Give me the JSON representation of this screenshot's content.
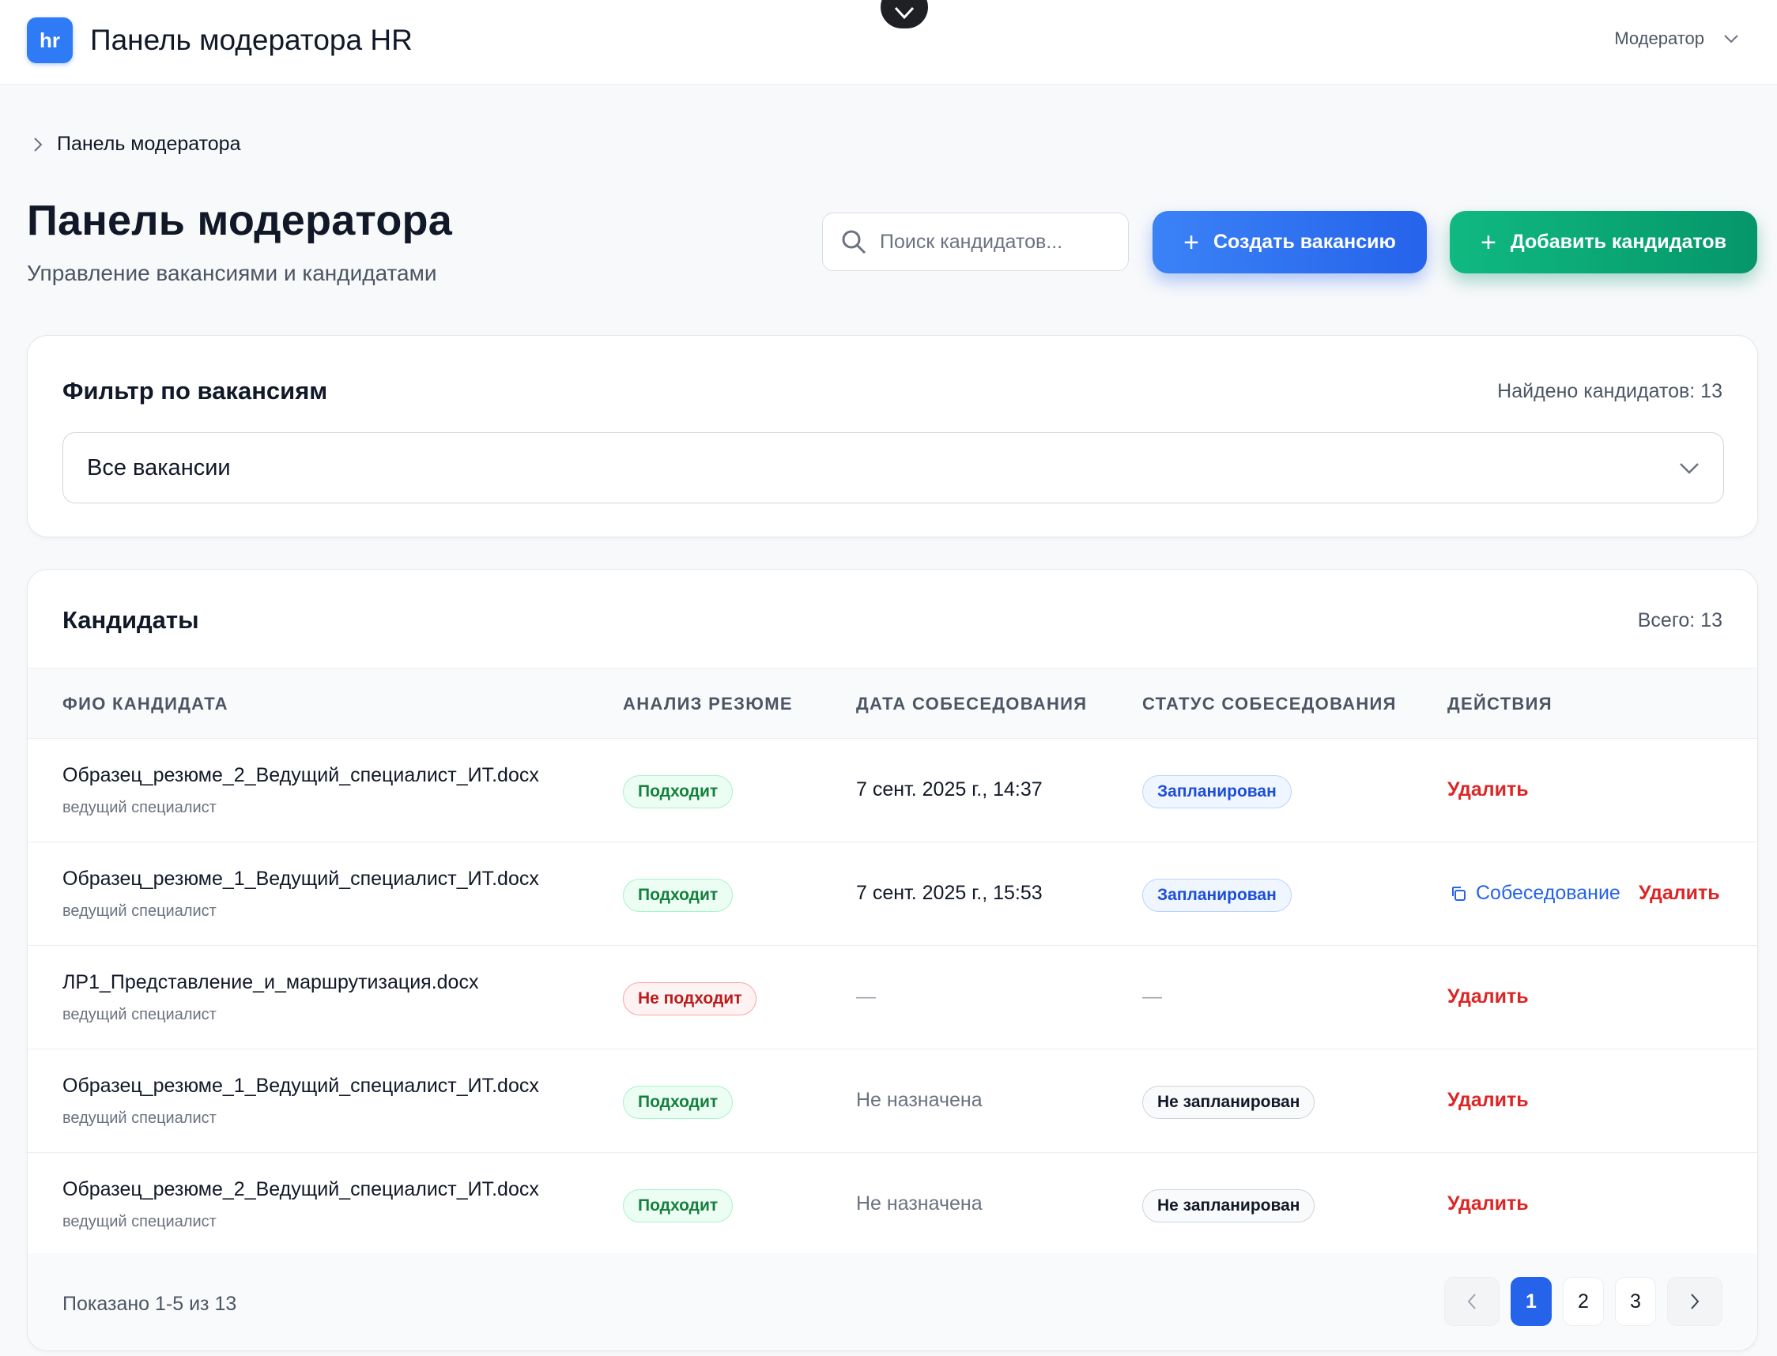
{
  "header": {
    "logo_text": "hr",
    "app_title": "Панель модератора HR",
    "role": "Модератор"
  },
  "breadcrumb": {
    "current": "Панель модератора"
  },
  "page": {
    "title": "Панель модератора",
    "subtitle": "Управление вакансиями и кандидатами"
  },
  "search": {
    "placeholder": "Поиск кандидатов..."
  },
  "buttons": {
    "create_vacancy": "Создать вакансию",
    "add_candidates": "Добавить кандидатов"
  },
  "filter": {
    "title": "Фильтр по вакансиям",
    "found_text": "Найдено кандидатов: 13",
    "selected": "Все вакансии"
  },
  "candidates": {
    "title": "Кандидаты",
    "total_text": "Всего: 13",
    "columns": [
      "ФИО КАНДИДАТА",
      "АНАЛИЗ РЕЗЮМЕ",
      "ДАТА СОБЕСЕДОВАНИЯ",
      "СТАТУС СОБЕСЕДОВАНИЯ",
      "ДЕЙСТВИЯ"
    ],
    "rows": [
      {
        "name": "Образец_резюме_2_Ведущий_специалист_ИТ.docx",
        "role": "ведущий специалист",
        "analysis": "Подходит",
        "date": "7 сент. 2025 г., 14:37",
        "status": "Запланирован",
        "delete": "Удалить"
      },
      {
        "name": "Образец_резюме_1_Ведущий_специалист_ИТ.docx",
        "role": "ведущий специалист",
        "analysis": "Подходит",
        "date": "7 сент. 2025 г., 15:53",
        "status": "Запланирован",
        "interview": "Собеседование",
        "delete": "Удалить"
      },
      {
        "name": "ЛР1_Представление_и_маршрутизация.docx",
        "role": "ведущий специалист",
        "analysis": "Не подходит",
        "date": "—",
        "status": "—",
        "delete": "Удалить"
      },
      {
        "name": "Образец_резюме_1_Ведущий_специалист_ИТ.docx",
        "role": "ведущий специалист",
        "analysis": "Подходит",
        "date": "Не назначена",
        "status": "Не запланирован",
        "delete": "Удалить"
      },
      {
        "name": "Образец_резюме_2_Ведущий_специалист_ИТ.docx",
        "role": "ведущий специалист",
        "analysis": "Подходит",
        "date": "Не назначена",
        "status": "Не запланирован",
        "delete": "Удалить"
      }
    ]
  },
  "pagination": {
    "shown_text": "Показано 1-5 из 13",
    "pages": [
      "1",
      "2",
      "3"
    ],
    "current": "1"
  },
  "colors": {
    "primary": "#2563eb",
    "success": "#059669",
    "danger": "#dc2626"
  }
}
